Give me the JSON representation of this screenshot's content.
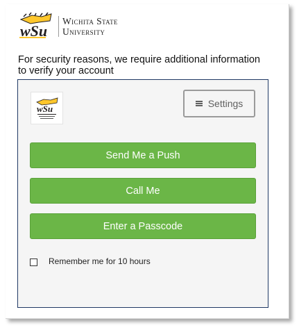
{
  "brand": {
    "university_line1": "Wichita State",
    "university_line2": "University",
    "logo_text": "WSU",
    "colors": {
      "gold": "#ffc72c",
      "black": "#231f20"
    }
  },
  "message": "For security reasons, we require additional information to verify your account",
  "duo": {
    "settings_label": "Settings",
    "settings_icon": "hamburger-menu-icon",
    "buttons": {
      "push": "Send Me a Push",
      "call": "Call Me",
      "passcode": "Enter a Passcode"
    },
    "remember_label": "Remember me for 10 hours",
    "remember_checked": false,
    "colors": {
      "button_green": "#6bb647",
      "panel_background": "#f5f5f5",
      "panel_border": "#1f3864"
    }
  }
}
